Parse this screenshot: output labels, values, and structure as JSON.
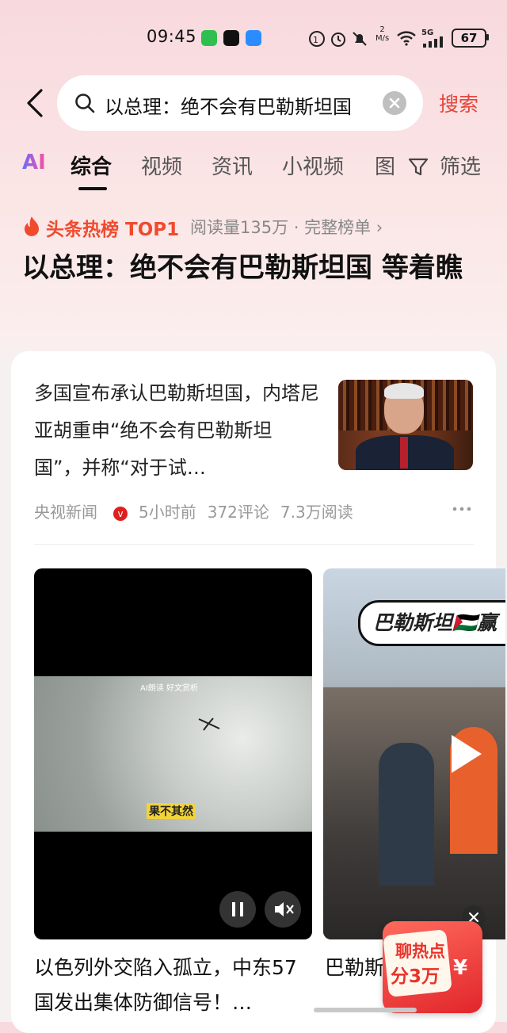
{
  "status_bar": {
    "time": "09:45",
    "net_speed": "2",
    "net_unit": "M/s",
    "signal": "5G",
    "battery": "67"
  },
  "search": {
    "query": "以总理：绝不会有巴勒斯坦国",
    "button": "搜索"
  },
  "tabs": [
    {
      "label": "AI"
    },
    {
      "label": "综合"
    },
    {
      "label": "视频"
    },
    {
      "label": "资讯"
    },
    {
      "label": "小视频"
    },
    {
      "label": "图"
    },
    {
      "label": "筛选"
    }
  ],
  "hot": {
    "badge": "头条热榜 TOP1",
    "meta": "阅读量135万 · 完整榜单 ›",
    "headline": "以总理：绝不会有巴勒斯坦国 等着瞧"
  },
  "article": {
    "title": "多国宣布承认巴勒斯坦国，内塔尼亚胡重申“绝不会有巴勒斯坦国”，并称“对于试…",
    "source": "央视新闻",
    "time": "5小时前",
    "comments": "372评论",
    "reads": "7.3万阅读"
  },
  "videos": [
    {
      "overlay_top": "AI朗读 好文赏析",
      "overlay_sub": "果不其然",
      "caption": "以色列外交陷入孤立，中东57国发出集体防御信号！…"
    },
    {
      "bubble": "巴勒斯坦🇵🇸赢",
      "caption": "巴勒斯"
    }
  ],
  "reward": {
    "line1": "聊热点",
    "line2": "分3万",
    "symbol": "¥"
  }
}
